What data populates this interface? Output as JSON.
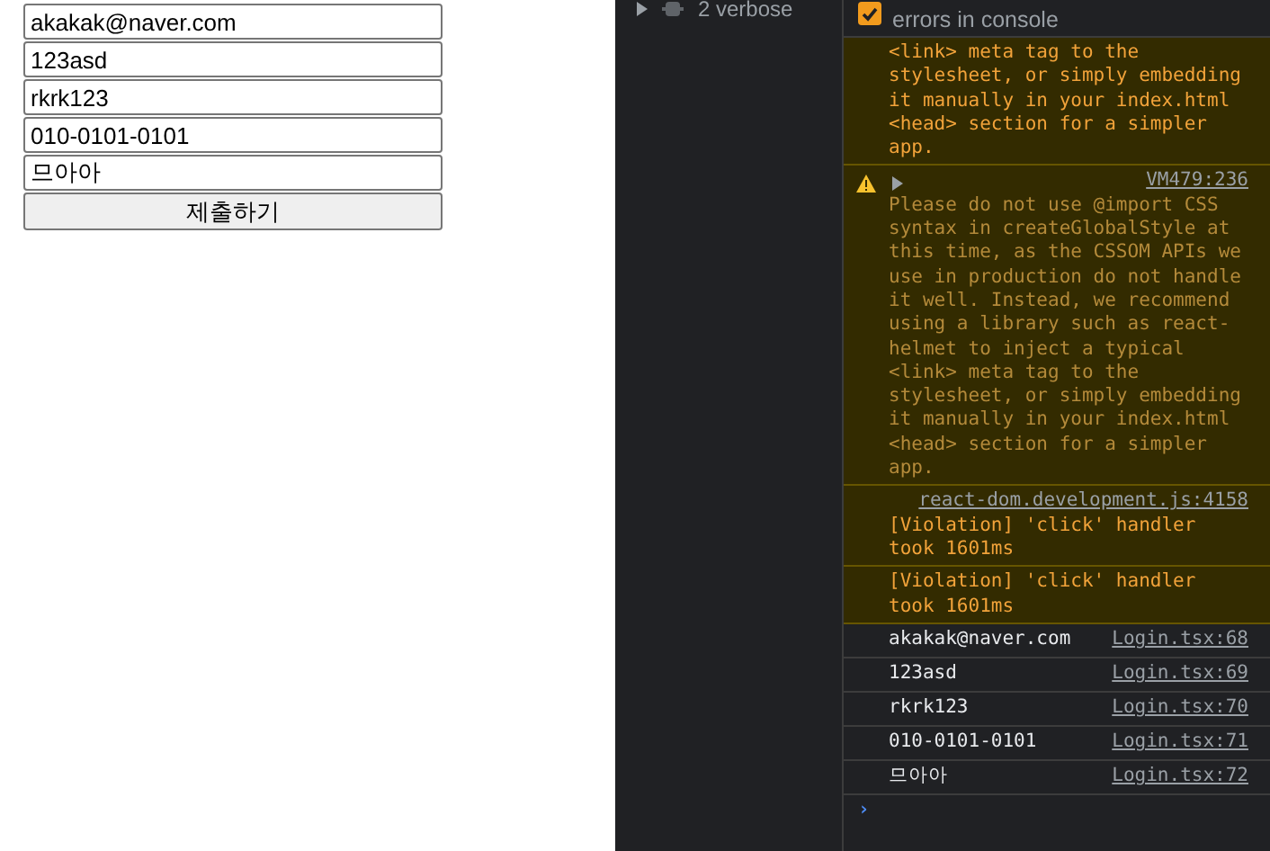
{
  "form": {
    "fields": [
      {
        "value": "akakak@naver.com"
      },
      {
        "value": "123asd"
      },
      {
        "value": "rkrk123"
      },
      {
        "value": "010-0101-0101"
      },
      {
        "value": "므아아"
      }
    ],
    "submit": "제출하기"
  },
  "sidebar": {
    "items": [
      {
        "label": "2 verbose",
        "expanded": false
      }
    ]
  },
  "console": {
    "setting": {
      "label": "errors in console",
      "checked": true
    },
    "messages": [
      {
        "kind": "warning",
        "icon": false,
        "text": "<link> meta tag to the\nstylesheet, or simply embedding\nit manually in your index.html\n<head> section for a simpler\napp."
      },
      {
        "kind": "warning",
        "icon": true,
        "source": "VM479:236",
        "dim": true,
        "text": "Please do not use @import CSS\nsyntax in createGlobalStyle at\nthis time, as the CSSOM APIs we\nuse in production do not handle\nit well. Instead, we recommend\nusing a library such as react-\nhelmet to inject a typical\n<link> meta tag to the\nstylesheet, or simply embedding\nit manually in your index.html\n<head> section for a simpler\napp."
      },
      {
        "kind": "warning",
        "icon": false,
        "source": "react-dom.development.js:4158",
        "dim": false,
        "text": "[Violation] 'click' handler\ntook 1601ms"
      },
      {
        "kind": "warning",
        "icon": false,
        "dim": false,
        "text": "[Violation] 'click' handler\ntook 1601ms"
      },
      {
        "kind": "log",
        "text": "akakak@naver.com",
        "source": "Login.tsx:68"
      },
      {
        "kind": "log",
        "text": "123asd",
        "source": "Login.tsx:69"
      },
      {
        "kind": "log",
        "text": "rkrk123",
        "source": "Login.tsx:70"
      },
      {
        "kind": "log",
        "text": "010-0101-0101",
        "source": "Login.tsx:71"
      },
      {
        "kind": "log",
        "text": "므아아",
        "source": "Login.tsx:72"
      }
    ],
    "prompt": "›"
  }
}
